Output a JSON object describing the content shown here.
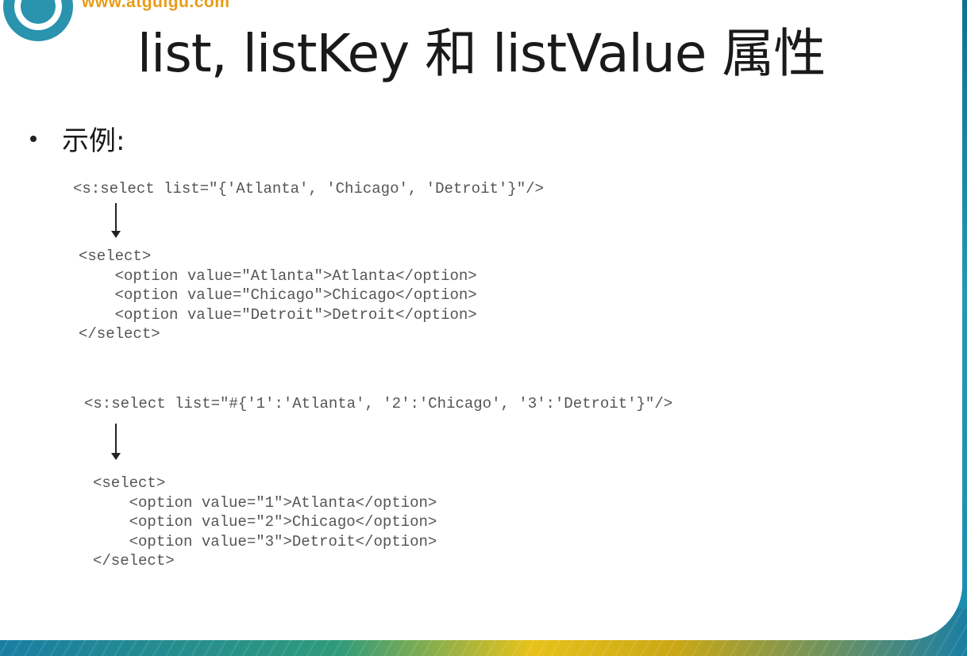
{
  "logo": {
    "url_text": "www.atguigu.com",
    "icon": "atguigu-logo-icon"
  },
  "slide": {
    "title": "list, listKey 和 listValue 属性",
    "bullet_label": "示例:"
  },
  "example1": {
    "source": "<s:select list=\"{'Atlanta', 'Chicago', 'Detroit'}\"/>",
    "output_lines": [
      "<select>",
      "    <option value=\"Atlanta\">Atlanta</option>",
      "    <option value=\"Chicago\">Chicago</option>",
      "    <option value=\"Detroit\">Detroit</option>",
      "</select>"
    ]
  },
  "example2": {
    "source": "<s:select list=\"#{'1':'Atlanta', '2':'Chicago', '3':'Detroit'}\"/>",
    "output_lines": [
      "<select>",
      "    <option value=\"1\">Atlanta</option>",
      "    <option value=\"2\">Chicago</option>",
      "    <option value=\"3\">Detroit</option>",
      "</select>"
    ]
  }
}
